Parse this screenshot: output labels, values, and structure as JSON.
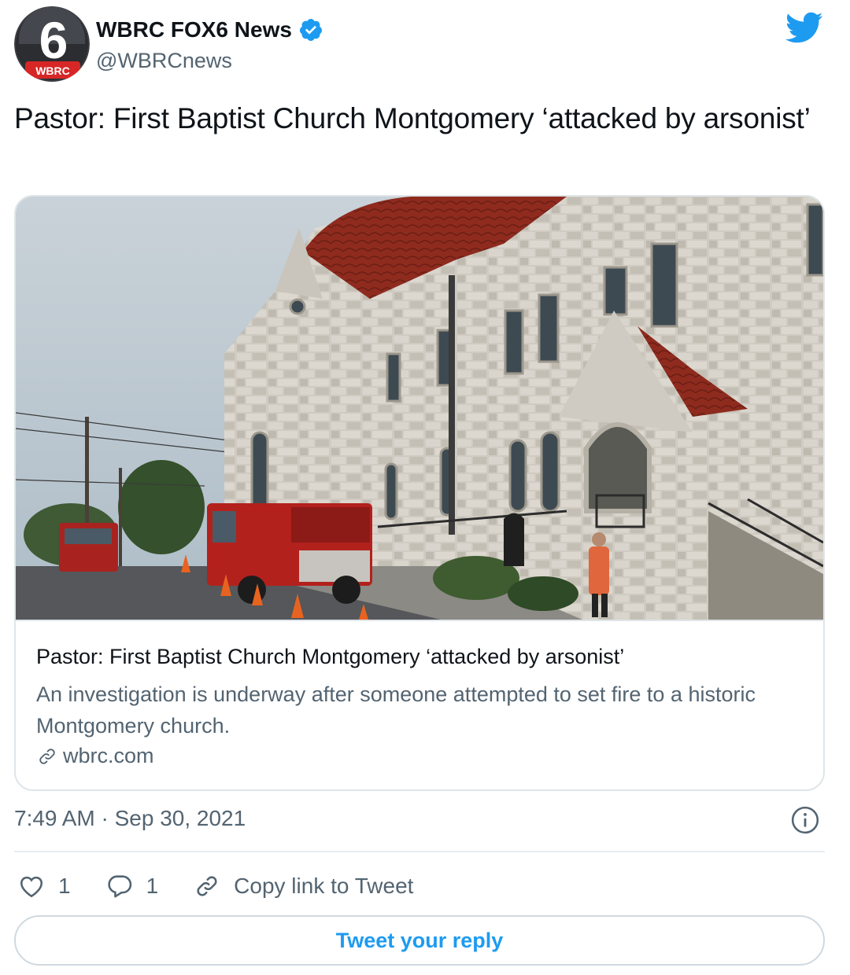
{
  "account": {
    "display_name": "WBRC FOX6 News",
    "handle": "@WBRCnews",
    "avatar_text": "6",
    "avatar_badge": "WBRC",
    "verified": true
  },
  "tweet": {
    "text": "Pastor: First Baptist Church Montgomery ‘attacked by arsonist’",
    "timestamp": "7:49 AM · Sep 30, 2021"
  },
  "card": {
    "image_description_icon": "church-photo",
    "title": "Pastor: First Baptist Church Montgomery ‘attacked by arsonist’",
    "description": "An investigation is underway after someone attempted to set fire to a historic Montgomery church.",
    "domain": "wbrc.com"
  },
  "actions": {
    "likes": "1",
    "replies": "1",
    "copy_link_label": "Copy link to Tweet"
  },
  "reply_button": {
    "label": "Tweet your reply"
  },
  "colors": {
    "accent": "#1d9bf0",
    "secondary_text": "#536471",
    "border": "#dfe5e9"
  }
}
